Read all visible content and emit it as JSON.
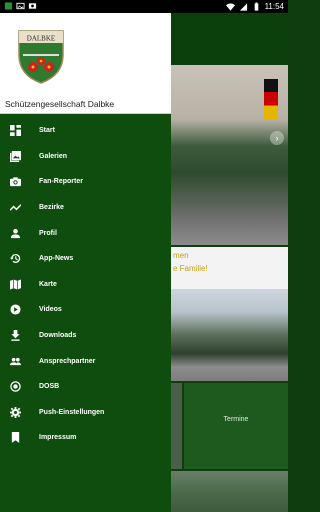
{
  "status_bar": {
    "time": "11:54",
    "left_icons": [
      "green-app-icon",
      "gallery-icon",
      "photo-icon"
    ],
    "right_icons": [
      "wifi-icon",
      "signal-icon",
      "battery-icon"
    ]
  },
  "drawer": {
    "club_name": "Schützengesellschaft Dalbke",
    "crest_text": "DALBKE",
    "items": [
      {
        "label": "Start",
        "icon": "dashboard-icon"
      },
      {
        "label": "Galerien",
        "icon": "gallery-icon"
      },
      {
        "label": "Fan-Reporter",
        "icon": "camera-icon"
      },
      {
        "label": "Bezirke",
        "icon": "trending-icon"
      },
      {
        "label": "Profil",
        "icon": "person-icon"
      },
      {
        "label": "App-News",
        "icon": "history-icon"
      },
      {
        "label": "Karte",
        "icon": "map-icon"
      },
      {
        "label": "Videos",
        "icon": "video-icon"
      },
      {
        "label": "Downloads",
        "icon": "download-icon"
      },
      {
        "label": "Ansprechpartner",
        "icon": "people-icon"
      },
      {
        "label": "DOSB",
        "icon": "radio-button-icon"
      },
      {
        "label": "Push-Einstellungen",
        "icon": "gear-icon"
      },
      {
        "label": "Impressum",
        "icon": "bookmark-icon"
      }
    ]
  },
  "background": {
    "news_line1": "men",
    "news_line2": "e Familie!",
    "tile_label": "Termine"
  },
  "colors": {
    "drawer_bg": "#0f4d0f",
    "accent_text": "#c3a11a"
  }
}
